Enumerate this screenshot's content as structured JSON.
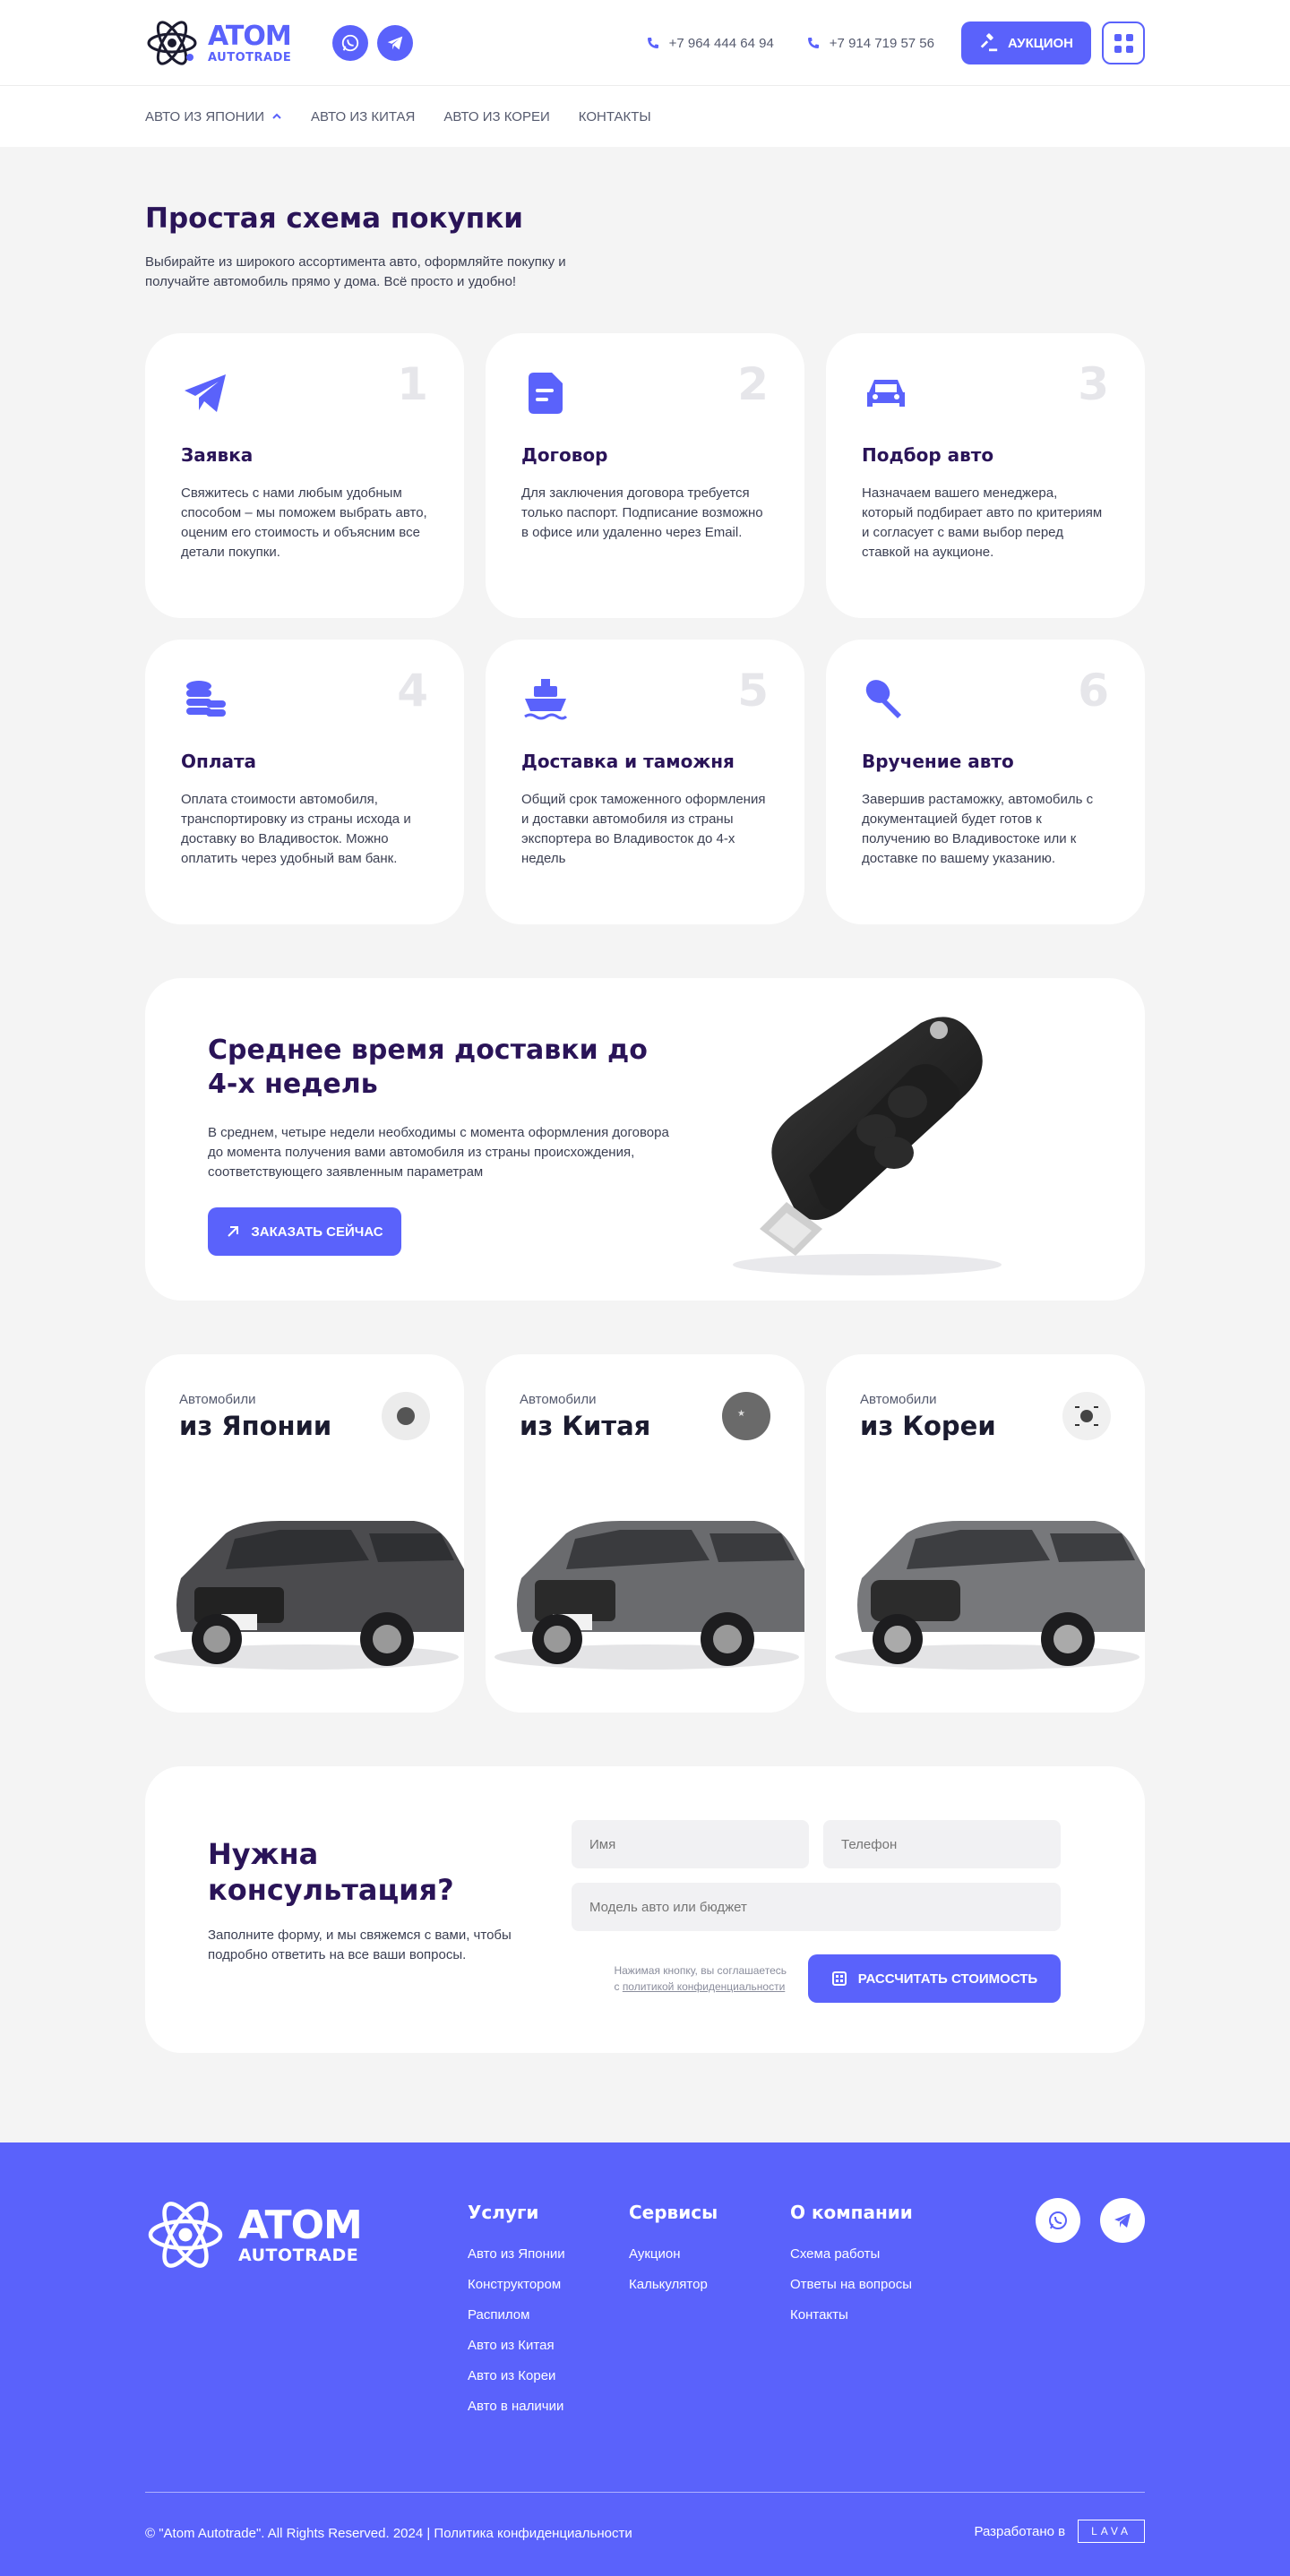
{
  "header": {
    "logo_main": "ATOM",
    "logo_sub": "AUTOTRADE",
    "phone1": "+7 964 444 64 94",
    "phone2": "+7 914 719 57 56",
    "auction_label": "Аукцион"
  },
  "nav": {
    "items": [
      {
        "label": "Авто из Японии"
      },
      {
        "label": "Авто из Китая"
      },
      {
        "label": "Авто из Кореи"
      },
      {
        "label": "Контакты"
      }
    ]
  },
  "steps": {
    "title": "Простая схема покупки",
    "subtitle": "Выбирайте из широкого ассортимента авто, оформляйте покупку и получайте автомобиль прямо у дома. Всё просто и удобно!",
    "items": [
      {
        "num": "1",
        "icon": "paper-plane-icon",
        "title": "Заявка",
        "text": "Свяжитесь с нами любым удобным способом – мы поможем выбрать авто, оценим его стоимость и объясним все детали покупки."
      },
      {
        "num": "2",
        "icon": "document-icon",
        "title": "Договор",
        "text": "Для заключения договора требуется только паспорт. Подписание возможно в офисе или удаленно через Email."
      },
      {
        "num": "3",
        "icon": "car-icon",
        "title": "Подбор авто",
        "text": "Назначаем вашего менеджера, который подбирает авто по критериям и согласует с вами выбор перед ставкой на аукционе."
      },
      {
        "num": "4",
        "icon": "coins-icon",
        "title": "Оплата",
        "text": "Оплата стоимости автомобиля, транспортировку из страны исхода и доставку во Владивосток. Можно оплатить через удобный вам банк."
      },
      {
        "num": "5",
        "icon": "ship-icon",
        "title": "Доставка и таможня",
        "text": "Общий срок таможенного оформления и доставки автомобиля из страны экспортера во Владивосток до 4-х недель"
      },
      {
        "num": "6",
        "icon": "key-icon",
        "title": "Вручение авто",
        "text": "Завершив растаможку, автомобиль с документацией будет готов к получению во Владивостоке или к доставке по вашему указанию."
      }
    ]
  },
  "promo": {
    "title": "Среднее время доставки до 4-х недель",
    "text": "В среднем, четыре недели необходимы с момента оформления договора до момента получения вами автомобиля из страны происхождения, соответствующего заявленным параметрам",
    "button": "Заказать сейчас"
  },
  "countries": [
    {
      "pre": "Автомобили",
      "name": "из Японии",
      "flag": "japan-flag-icon"
    },
    {
      "pre": "Автомобили",
      "name": "из Китая",
      "flag": "china-flag-icon"
    },
    {
      "pre": "Автомобили",
      "name": "из Кореи",
      "flag": "korea-flag-icon"
    }
  ],
  "consult": {
    "title": "Нужна консультация?",
    "text": "Заполните форму, и мы свяжемся с вами, чтобы подробно ответить на все ваши вопросы.",
    "name_placeholder": "Имя",
    "phone_placeholder": "Телефон",
    "model_placeholder": "Модель авто или бюджет",
    "agree_text": "Нажимая кнопку, вы соглашаетесь",
    "agree_prefix": "с",
    "agree_link": "политикой конфиденциальности",
    "button": "Рассчитать стоимость"
  },
  "footer": {
    "logo_main": "ATOM",
    "logo_sub": "AUTOTRADE",
    "col1": {
      "title": "Услуги",
      "links": [
        "Авто из Японии",
        "Конструктором",
        "Распилом",
        "Авто из Китая",
        "Авто из Кореи",
        "Авто в наличии"
      ]
    },
    "col2": {
      "title": "Сервисы",
      "links": [
        "Аукцион",
        "Калькулятор"
      ]
    },
    "col3": {
      "title": "О компании",
      "links": [
        "Схема работы",
        "Ответы на вопросы",
        "Контакты"
      ]
    },
    "copyright": "©  \"Atom Autotrade\". All Rights Reserved. 2024 | Политика конфиденциальности",
    "developed": "Разработано в",
    "dev_brand": "LAVA"
  },
  "colors": {
    "accent": "#5a62fb",
    "title": "#2a1458",
    "background": "#f4f4f4"
  }
}
